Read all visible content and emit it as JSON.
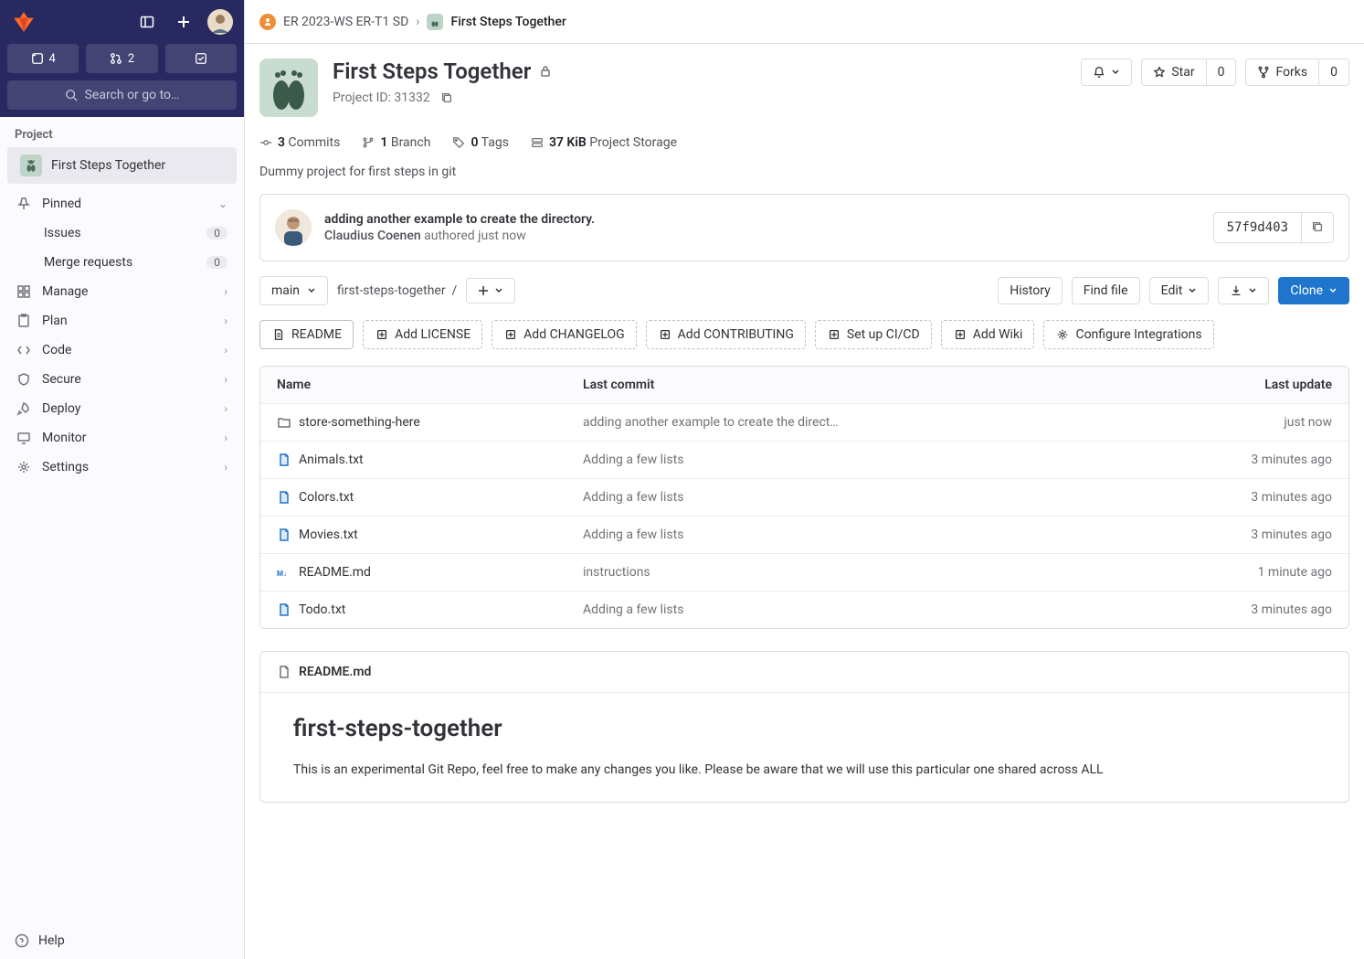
{
  "sidebar": {
    "counts": {
      "issues": "4",
      "mrs": "2"
    },
    "search_placeholder": "Search or go to…",
    "section_label": "Project",
    "project_name": "First Steps Together",
    "pinned_label": "Pinned",
    "pinned_items": [
      {
        "label": "Issues",
        "count": "0"
      },
      {
        "label": "Merge requests",
        "count": "0"
      }
    ],
    "nav": [
      {
        "label": "Manage"
      },
      {
        "label": "Plan"
      },
      {
        "label": "Code"
      },
      {
        "label": "Secure"
      },
      {
        "label": "Deploy"
      },
      {
        "label": "Monitor"
      },
      {
        "label": "Settings"
      }
    ],
    "help_label": "Help"
  },
  "breadcrumb": {
    "group": "ER 2023-WS ER-T1 SD",
    "project": "First Steps Together"
  },
  "project": {
    "title": "First Steps Together",
    "id_label": "Project ID: 31332",
    "star_label": "Star",
    "star_count": "0",
    "forks_label": "Forks",
    "forks_count": "0",
    "stats": {
      "commits_n": "3",
      "commits_label": "Commits",
      "branches_n": "1",
      "branches_label": "Branch",
      "tags_n": "0",
      "tags_label": "Tags",
      "storage_n": "37 KiB",
      "storage_label": "Project Storage"
    },
    "description": "Dummy project for first steps in git"
  },
  "last_commit": {
    "message": "adding another example to create the directory.",
    "author": "Claudius Coenen",
    "authored": "authored just now",
    "sha": "57f9d403"
  },
  "toolbar": {
    "branch": "main",
    "path": "first-steps-together",
    "history": "History",
    "find_file": "Find file",
    "edit": "Edit",
    "clone": "Clone"
  },
  "suggestions": [
    "README",
    "Add LICENSE",
    "Add CHANGELOG",
    "Add CONTRIBUTING",
    "Set up CI/CD",
    "Add Wiki",
    "Configure Integrations"
  ],
  "files": {
    "headers": {
      "name": "Name",
      "commit": "Last commit",
      "update": "Last update"
    },
    "rows": [
      {
        "icon": "folder",
        "name": "store-something-here",
        "commit": "adding another example to create the direct…",
        "time": "just now"
      },
      {
        "icon": "file",
        "name": "Animals.txt",
        "commit": "Adding a few lists",
        "time": "3 minutes ago"
      },
      {
        "icon": "file",
        "name": "Colors.txt",
        "commit": "Adding a few lists",
        "time": "3 minutes ago"
      },
      {
        "icon": "file",
        "name": "Movies.txt",
        "commit": "Adding a few lists",
        "time": "3 minutes ago"
      },
      {
        "icon": "readme",
        "name": "README.md",
        "commit": "instructions",
        "time": "1 minute ago"
      },
      {
        "icon": "file",
        "name": "Todo.txt",
        "commit": "Adding a few lists",
        "time": "3 minutes ago"
      }
    ]
  },
  "readme": {
    "filename": "README.md",
    "heading": "first-steps-together",
    "body": "This is an experimental Git Repo, feel free to make any changes you like. Please be aware that we will use this particular one shared across ALL"
  }
}
